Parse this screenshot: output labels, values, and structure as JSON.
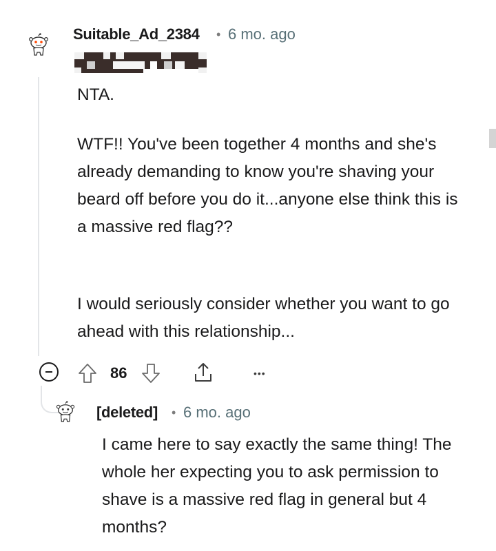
{
  "comment": {
    "author": "Suitable_Ad_2384",
    "separator": "•",
    "age": "6 mo. ago",
    "paragraphs": [
      "NTA.",
      "WTF!! You've been together 4 months and she's already demanding to know you're shaving your beard off before you do it...anyone else think this is a massive red flag??",
      "I would seriously consider whether you want to go ahead with this relationship..."
    ],
    "score": "86",
    "more_label": "•••"
  },
  "reply": {
    "author": "[deleted]",
    "separator": "•",
    "age": "6 mo. ago",
    "paragraphs": [
      "I came here to say exactly the same thing! The whole her expecting you to ask permission to shave is a massive red flag in general but 4 months?"
    ]
  },
  "icons": {
    "avatar": "snoo-avatar-icon",
    "collapse": "collapse-minus-icon",
    "upvote": "upvote-arrow-icon",
    "downvote": "downvote-arrow-icon",
    "share": "share-icon",
    "more": "more-options-icon"
  },
  "colors": {
    "text": "#1a1a1b",
    "meta": "#576f76",
    "thread_line": "#e3e5e8",
    "redaction": "#3a2d2a"
  }
}
